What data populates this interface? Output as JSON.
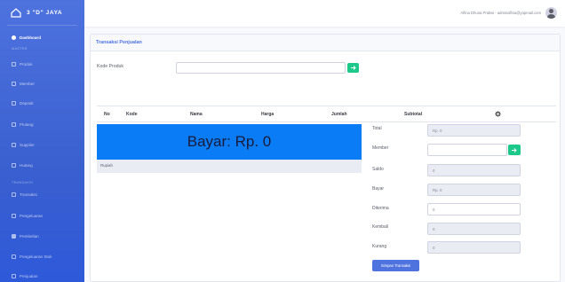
{
  "app": {
    "brand": "3 \"D\" JAYA"
  },
  "sidebar": {
    "items": [
      {
        "label": "Dashboard",
        "icon": "gauge-icon",
        "active": true
      },
      {
        "label": "Produk",
        "icon": "list-icon"
      },
      {
        "label": "Member",
        "icon": "list-icon"
      },
      {
        "label": "Deposit",
        "icon": "list-icon"
      },
      {
        "label": "Piutang",
        "icon": "list-icon"
      },
      {
        "label": "Supplier",
        "icon": "list-icon"
      },
      {
        "label": "Hutang",
        "icon": "list-icon"
      },
      {
        "label": "Transaksi",
        "icon": "list-icon"
      },
      {
        "label": "Pengeluaran",
        "icon": "list-icon"
      },
      {
        "label": "Pembelian",
        "icon": "grid-icon"
      },
      {
        "label": "Pengeluaran Stok",
        "icon": "list-icon"
      },
      {
        "label": "Penjualan",
        "icon": "list-icon"
      }
    ],
    "headings": [
      "MASTER",
      "TRANSAKSI"
    ]
  },
  "topbar": {
    "user_name": "Alfina Dhuna Pratiwi - adminalfina@yopmail.com"
  },
  "card": {
    "title": "Transaksi Penjualan",
    "kode_label": "Kode Produk",
    "kode_placeholder": ""
  },
  "table": {
    "columns": [
      "No",
      "Kode",
      "Nama",
      "Harga",
      "Jumlah",
      "Subtotal"
    ],
    "settings_icon": "gear-icon"
  },
  "bayar": {
    "text": "Bayar: Rp. 0",
    "terbilang": "Rupiah"
  },
  "form": {
    "total_label": "Total",
    "total_value": "Rp. 0",
    "member_label": "Member",
    "member_value": "",
    "saldo_label": "Saldo",
    "saldo_value": "0",
    "bayar_label": "Bayar",
    "bayar_value": "Rp. 0",
    "diterima_label": "Diterima",
    "diterima_value": "0",
    "kembali_label": "Kembali",
    "kembali_value": "0",
    "kurang_label": "Kurang",
    "kurang_value": "0",
    "save_label": "Simpan Transaksi"
  },
  "colors": {
    "primary": "#4e73df",
    "success": "#1cc88a",
    "bayar_bg": "#0a7cf5"
  }
}
